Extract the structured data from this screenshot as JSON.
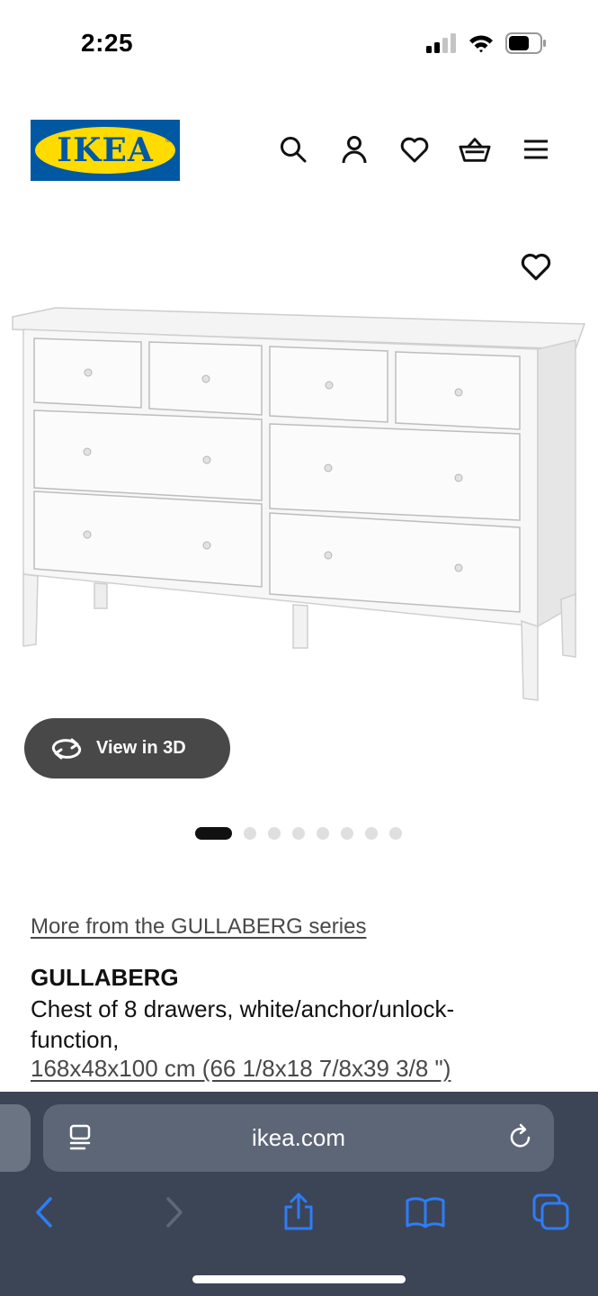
{
  "status_bar": {
    "time": "2:25",
    "signal_icon": "cellular-signal-icon",
    "wifi_icon": "wifi-icon",
    "battery_icon": "battery-icon"
  },
  "header": {
    "logo_text": "IKEA",
    "logo_colors": {
      "blue": "#0058a3",
      "yellow": "#ffdb00"
    },
    "icons": [
      "search-icon",
      "account-icon",
      "heart-icon",
      "basket-icon",
      "menu-icon"
    ]
  },
  "product_image": {
    "favorite_icon": "heart-outline-icon",
    "view3d_label": "View in 3D",
    "view3d_icon": "rotate-3d-icon"
  },
  "carousel": {
    "total": 8,
    "active_index": 0
  },
  "product": {
    "series_link": "More from the GULLABERG series",
    "name": "GULLABERG",
    "description": "Chest of 8 drawers, white/anchor/unlock-function,",
    "size": "168x48x100 cm (66 1/8x18 7/8x39 3/8 \")"
  },
  "browser": {
    "url": "ikea.com",
    "toolbar_icons": [
      "back-icon",
      "forward-icon",
      "share-icon",
      "bookmarks-icon",
      "tabs-icon"
    ],
    "accent_color": "#2f7cf6",
    "bar_color": "#3b4556"
  }
}
